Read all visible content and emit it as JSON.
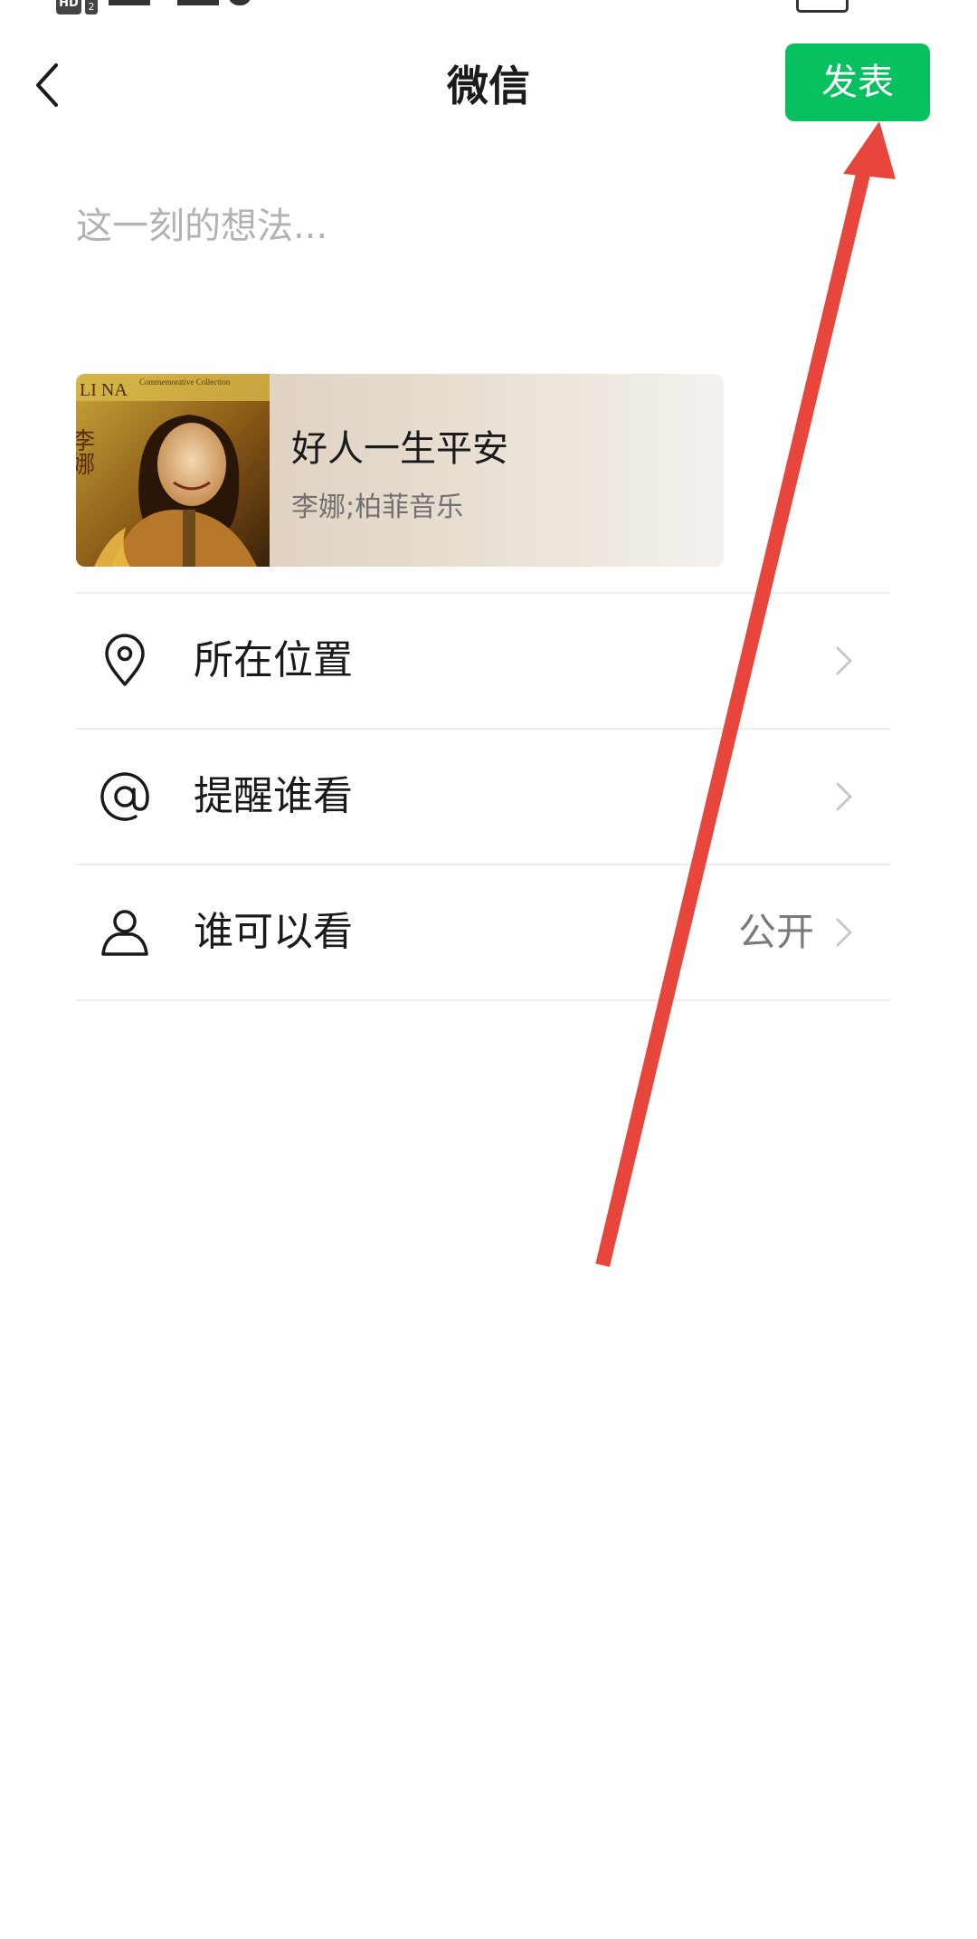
{
  "status_bar": {
    "network_badge": "HD",
    "sim_badge": "2"
  },
  "header": {
    "back_icon": "chevron-left-icon",
    "title": "微信",
    "publish_label": "发表",
    "publish_color": "#07c160"
  },
  "composer": {
    "placeholder": "这一刻的想法..."
  },
  "music_card": {
    "cover_text": "LI NA",
    "cover_subtext": "Commemorative Collection",
    "cover_chinese": "李娜",
    "title": "好人一生平安",
    "artist": "李娜;柏菲音乐"
  },
  "options": [
    {
      "icon": "location-pin-icon",
      "label": "所在位置",
      "value": ""
    },
    {
      "icon": "at-icon",
      "label": "提醒谁看",
      "value": ""
    },
    {
      "icon": "person-icon",
      "label": "谁可以看",
      "value": "公开"
    }
  ],
  "annotation": {
    "icon": "red-arrow-icon",
    "color": "#e8453c"
  }
}
